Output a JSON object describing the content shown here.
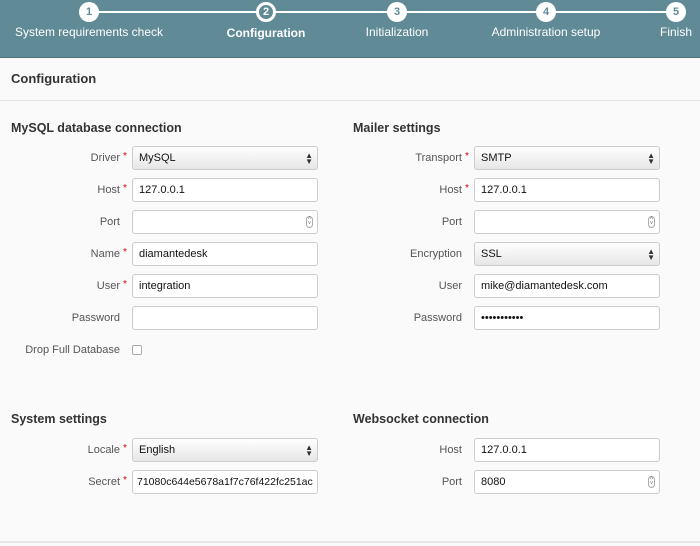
{
  "steps": [
    {
      "num": "1",
      "label": "System requirements check"
    },
    {
      "num": "2",
      "label": "Configuration"
    },
    {
      "num": "3",
      "label": "Initialization"
    },
    {
      "num": "4",
      "label": "Administration setup"
    },
    {
      "num": "5",
      "label": "Finish"
    }
  ],
  "page_title": "Configuration",
  "mysql": {
    "title": "MySQL database connection",
    "driver_label": "Driver",
    "driver": "MySQL",
    "host_label": "Host",
    "host": "127.0.0.1",
    "port_label": "Port",
    "port": "",
    "name_label": "Name",
    "name": "diamantedesk",
    "user_label": "User",
    "user": "integration",
    "password_label": "Password",
    "password": "",
    "drop_label": "Drop Full Database"
  },
  "mailer": {
    "title": "Mailer settings",
    "transport_label": "Transport",
    "transport": "SMTP",
    "host_label": "Host",
    "host": "127.0.0.1",
    "port_label": "Port",
    "port": "",
    "encryption_label": "Encryption",
    "encryption": "SSL",
    "user_label": "User",
    "user": "mike@diamantedesk.com",
    "password_label": "Password",
    "password": "•••••••••••"
  },
  "system": {
    "title": "System settings",
    "locale_label": "Locale",
    "locale": "English",
    "secret_label": "Secret",
    "secret": "71080c644e5678a1f7c76f422fc251ac"
  },
  "websocket": {
    "title": "Websocket connection",
    "host_label": "Host",
    "host": "127.0.0.1",
    "port_label": "Port",
    "port": "8080"
  },
  "required_mark": "*",
  "colors": {
    "header": "#5f8a96",
    "required": "#cc0000"
  }
}
